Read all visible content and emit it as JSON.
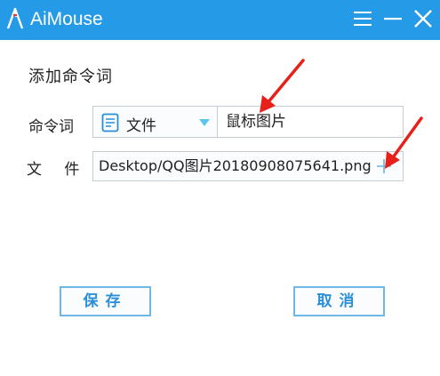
{
  "window": {
    "title": "AiMouse",
    "icons": [
      "aimouse-logo-icon",
      "menu-icon",
      "minimize-icon",
      "close-icon"
    ],
    "titlebar_color": "#259ae6"
  },
  "form": {
    "heading": "添加命令词",
    "command_label": "命令词",
    "command_type": "文件",
    "command_word": "鼠标图片",
    "file_label": "文 件",
    "file_path": "Desktop/QQ图片20180908075641.png"
  },
  "buttons": {
    "save": "保存",
    "cancel": "取消"
  },
  "accent_color": "#2a8fd6",
  "annotation_color": "#e8201a"
}
